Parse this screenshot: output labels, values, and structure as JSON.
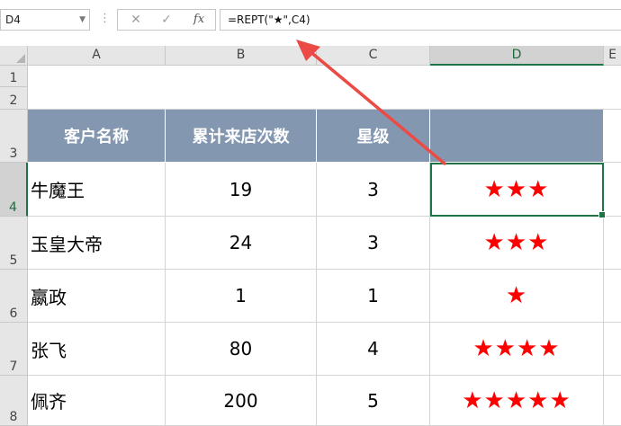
{
  "name_box": {
    "value": "D4",
    "dropdown_icon": "chevron-down-icon"
  },
  "formula_bar": {
    "cancel_icon": "✕",
    "enter_icon": "✓",
    "fx_label": "fx",
    "formula": "=REPT(\"★\",C4)"
  },
  "columns": [
    "A",
    "B",
    "C",
    "D",
    "E"
  ],
  "rows": [
    "1",
    "2",
    "3",
    "4",
    "5",
    "6",
    "7",
    "8"
  ],
  "table": {
    "headers": [
      "客户名称",
      "累计来店次数",
      "星级",
      ""
    ],
    "records": [
      {
        "name": "牛魔王",
        "visits": "19",
        "level": "3",
        "stars": "★★★"
      },
      {
        "name": "玉皇大帝",
        "visits": "24",
        "level": "3",
        "stars": "★★★"
      },
      {
        "name": "嬴政",
        "visits": "1",
        "level": "1",
        "stars": "★"
      },
      {
        "name": "张飞",
        "visits": "80",
        "level": "4",
        "stars": "★★★★"
      },
      {
        "name": "佩齐",
        "visits": "200",
        "level": "5",
        "stars": "★★★★★"
      }
    ]
  },
  "selected_cell": "D4",
  "colors": {
    "header_fill": "#8497b0",
    "star": "#ff0000",
    "selection": "#217346",
    "arrow": "#ec4a45"
  }
}
